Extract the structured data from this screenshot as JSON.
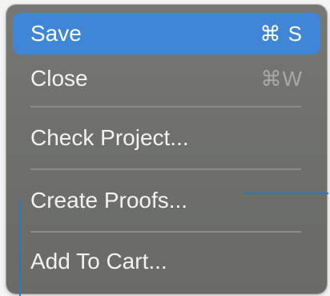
{
  "menu": {
    "items": [
      {
        "label": "Save",
        "shortcut": "⌘ S"
      },
      {
        "label": "Close",
        "shortcut": "⌘W"
      },
      {
        "label": "Check Project..."
      },
      {
        "label": "Create Proofs..."
      },
      {
        "label": "Add To Cart..."
      }
    ]
  },
  "colors": {
    "menu_background": "#70716d",
    "highlight": "#3f86d6",
    "text": "#f2f2f2",
    "shortcut_disabled": "#a9aaa6",
    "separator": "#8a8b87",
    "guide_line": "#2f74c8"
  }
}
